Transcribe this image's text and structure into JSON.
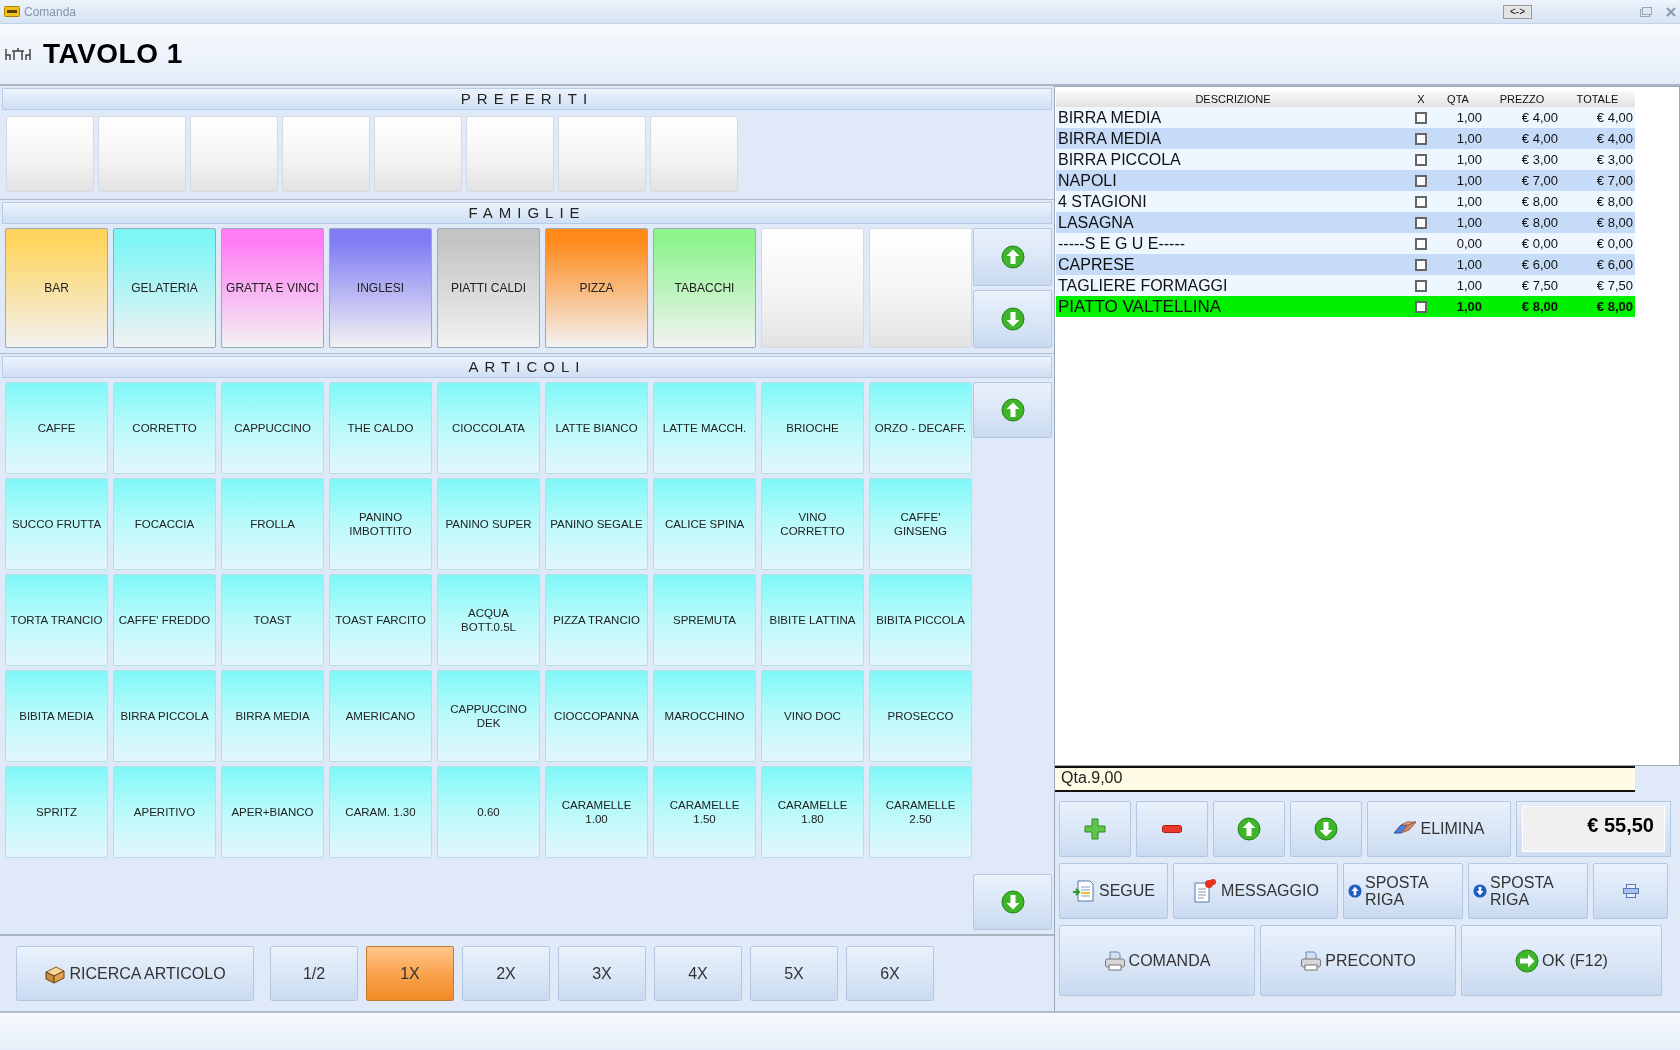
{
  "window": {
    "title": "Comanda",
    "resize_button": "<->"
  },
  "header": {
    "title": "TAVOLO 1"
  },
  "favorites": {
    "title": "PREFERITI",
    "items": [
      {
        "kind": "empty"
      },
      {
        "kind": "empty"
      },
      {
        "kind": "empty"
      },
      {
        "kind": "empty"
      },
      {
        "kind": "empty"
      },
      {
        "kind": "empty"
      },
      {
        "kind": "empty"
      },
      {
        "kind": "empty"
      }
    ]
  },
  "families": {
    "title": "FAMIGLIE",
    "items": [
      {
        "kind": "family",
        "label": "BAR",
        "color": "#ffd45e"
      },
      {
        "kind": "family",
        "label": "GELATERIA",
        "color": "#7ff6f6"
      },
      {
        "kind": "family",
        "label": "GRATTA E VINCI",
        "color": "#ff7cf4"
      },
      {
        "kind": "family",
        "label": "INGLESI",
        "color": "#7f7cf4"
      },
      {
        "kind": "family",
        "label": "PIATTI CALDI",
        "color": "#c4c4c4"
      },
      {
        "kind": "family",
        "label": "PIZZA",
        "color": "#ff8a1a"
      },
      {
        "kind": "family",
        "label": "TABACCHI",
        "color": "#8ef58e"
      },
      {
        "kind": "empty"
      },
      {
        "kind": "empty"
      }
    ]
  },
  "articles": {
    "title": "ARTICOLI",
    "items": [
      "CAFFE",
      "CORRETTO",
      "CAPPUCCINO",
      "THE CALDO",
      "CIOCCOLATA",
      "LATTE BIANCO",
      "LATTE MACCH.",
      "BRIOCHE",
      "ORZO - DECAFF.",
      "SUCCO FRUTTA",
      "FOCACCIA",
      "FROLLA",
      "PANINO\nIMBOTTITO",
      "PANINO SUPER",
      "PANINO SEGALE",
      "CALICE SPINA",
      "VINO\nCORRETTO",
      "CAFFE'\nGINSENG",
      "TORTA TRANCIO",
      "CAFFE' FREDDO",
      "TOAST",
      "TOAST FARCITO",
      "ACQUA\nBOTT.0.5L",
      "PIZZA TRANCIO",
      "SPREMUTA",
      "BIBITE LATTINA",
      "BIBITA PICCOLA",
      "BIBITA MEDIA",
      "BIRRA PICCOLA",
      "BIRRA MEDIA",
      "AMERICANO",
      "CAPPUCCINO\nDEK",
      "CIOCCOPANNA",
      "MAROCCHINO",
      "VINO DOC",
      "PROSECCO",
      "SPRITZ",
      "APERITIVO",
      "APER+BIANCO",
      "CARAM. 1.30",
      "0.60",
      "CARAMELLE\n1.00",
      "CARAMELLE\n1.50",
      "CARAMELLE\n1.80",
      "CARAMELLE\n2.50"
    ]
  },
  "search_button": "RICERCA ARTICOLO",
  "multipliers": [
    {
      "label": "1/2",
      "selected": false
    },
    {
      "label": "1X",
      "selected": true
    },
    {
      "label": "2X",
      "selected": false
    },
    {
      "label": "3X",
      "selected": false
    },
    {
      "label": "4X",
      "selected": false
    },
    {
      "label": "5X",
      "selected": false
    },
    {
      "label": "6X",
      "selected": false
    }
  ],
  "order": {
    "columns": [
      "DESCRIZIONE",
      "X",
      "QTA",
      "PREZZO",
      "TOTALE"
    ],
    "rows": [
      {
        "description": "BIRRA MEDIA",
        "checked": false,
        "quantity": "1,00",
        "price": "€ 4,00",
        "total": "€ 4,00",
        "selected": false
      },
      {
        "description": "BIRRA MEDIA",
        "checked": false,
        "quantity": "1,00",
        "price": "€ 4,00",
        "total": "€ 4,00",
        "selected": false
      },
      {
        "description": "BIRRA PICCOLA",
        "checked": false,
        "quantity": "1,00",
        "price": "€ 3,00",
        "total": "€ 3,00",
        "selected": false
      },
      {
        "description": "NAPOLI",
        "checked": false,
        "quantity": "1,00",
        "price": "€ 7,00",
        "total": "€ 7,00",
        "selected": false
      },
      {
        "description": "4 STAGIONI",
        "checked": false,
        "quantity": "1,00",
        "price": "€ 8,00",
        "total": "€ 8,00",
        "selected": false
      },
      {
        "description": "LASAGNA",
        "checked": false,
        "quantity": "1,00",
        "price": "€ 8,00",
        "total": "€ 8,00",
        "selected": false
      },
      {
        "description": "-----S E G U E-----",
        "checked": false,
        "quantity": "0,00",
        "price": "€ 0,00",
        "total": "€ 0,00",
        "selected": false
      },
      {
        "description": "CAPRESE",
        "checked": false,
        "quantity": "1,00",
        "price": "€ 6,00",
        "total": "€ 6,00",
        "selected": false
      },
      {
        "description": "TAGLIERE FORMAGGI",
        "checked": false,
        "quantity": "1,00",
        "price": "€ 7,50",
        "total": "€ 7,50",
        "selected": false
      },
      {
        "description": "PIATTO VALTELLINA",
        "checked": false,
        "quantity": "1,00",
        "price": "€ 8,00",
        "total": "€ 8,00",
        "selected": true
      }
    ],
    "quantity_total": "Qta.9,00",
    "grand_total": "€ 55,50"
  },
  "actions": {
    "delete": "ELIMINA",
    "follow": "SEGUE",
    "message": "MESSAGGIO",
    "move_up": "SPOSTA RIGA",
    "move_down": "SPOSTA RIGA",
    "send_order": "COMANDA",
    "pre_bill": "PRECONTO",
    "ok": "OK (F12)"
  }
}
